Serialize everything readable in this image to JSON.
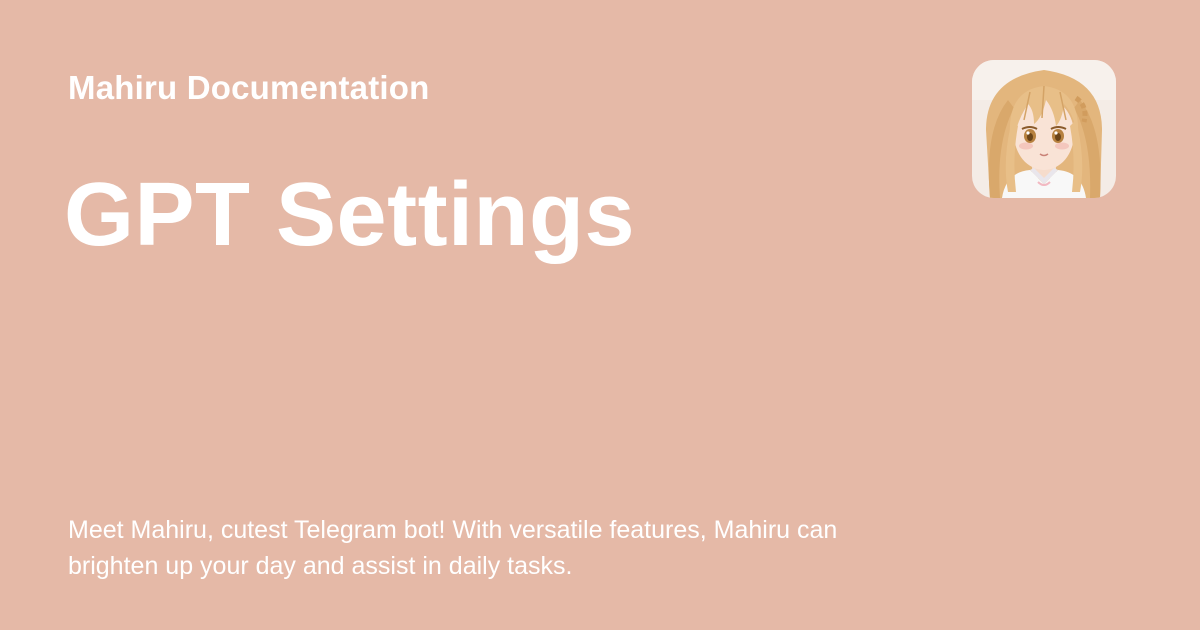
{
  "colors": {
    "background": "#e5b9a7",
    "text": "#ffffff"
  },
  "site": {
    "name": "Mahiru Documentation",
    "logo_icon": "mahiru-avatar-icon"
  },
  "page": {
    "title": "GPT Settings",
    "description": "Meet Mahiru, cutest Telegram bot! With versatile features, Mahiru can brighten up your day and assist in daily tasks."
  }
}
